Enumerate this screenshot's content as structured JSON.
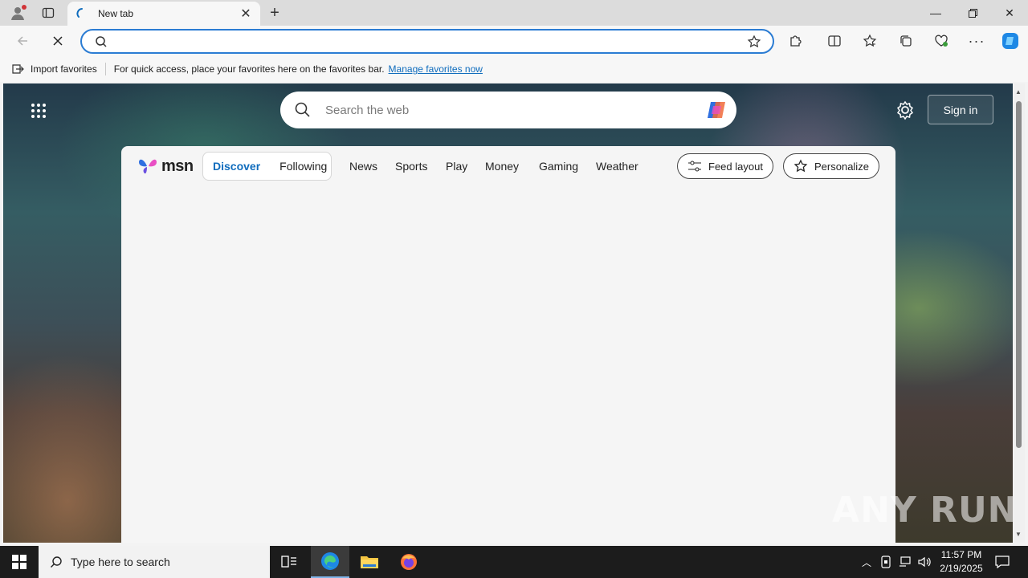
{
  "browser": {
    "tab_title": "New tab",
    "address_value": "",
    "favorites_bar": {
      "import_label": "Import favorites",
      "message": "For quick access, place your favorites here on the favorites bar.",
      "manage_link": "Manage favorites now"
    }
  },
  "newtab": {
    "search_placeholder": "Search the web",
    "sign_in_label": "Sign in",
    "msn_logo_text": "msn",
    "feed_tabs": [
      "Discover",
      "Following"
    ],
    "nav_links": [
      "News",
      "Sports",
      "Play",
      "Money",
      "Gaming",
      "Weather"
    ],
    "feed_layout_label": "Feed layout",
    "personalize_label": "Personalize",
    "watermark": "ANY RUN"
  },
  "taskbar": {
    "search_placeholder": "Type here to search",
    "time": "11:57 PM",
    "date": "2/19/2025"
  },
  "colors": {
    "accent": "#0f6cbd",
    "address_border": "#2b7cd3",
    "taskbar": "#1c1c1c"
  }
}
